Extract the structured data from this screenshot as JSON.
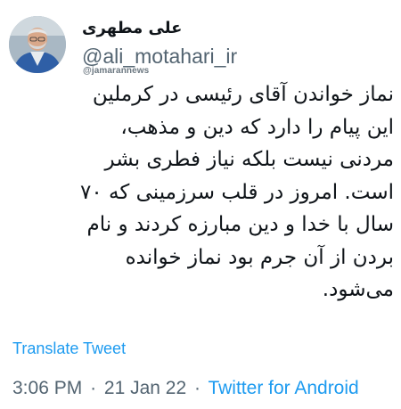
{
  "author": {
    "display_name": "علی مطهری",
    "handle": "@ali_motahari_ir"
  },
  "watermark": "@jamarannews",
  "tweet": {
    "lines": [
      "نماز خواندن آقای رئیسی در کرملین",
      "این پیام را دارد که دین و مذهب،",
      "مردنی نیست بلکه نیاز فطری بشر",
      "است. امروز در قلب سرزمینی که ۷۰",
      "سال با خدا و دین مبارزه کردند و نام",
      "بردن از آن جرم بود نماز خوانده",
      "می‌شود."
    ]
  },
  "translate_label": "Translate Tweet",
  "meta": {
    "time": "3:06 PM",
    "separator": "·",
    "date": "21 Jan 22",
    "source": "Twitter for Android"
  },
  "colors": {
    "link": "#1d9bf0",
    "secondary_text": "#536471",
    "primary_text": "#0f1419"
  }
}
